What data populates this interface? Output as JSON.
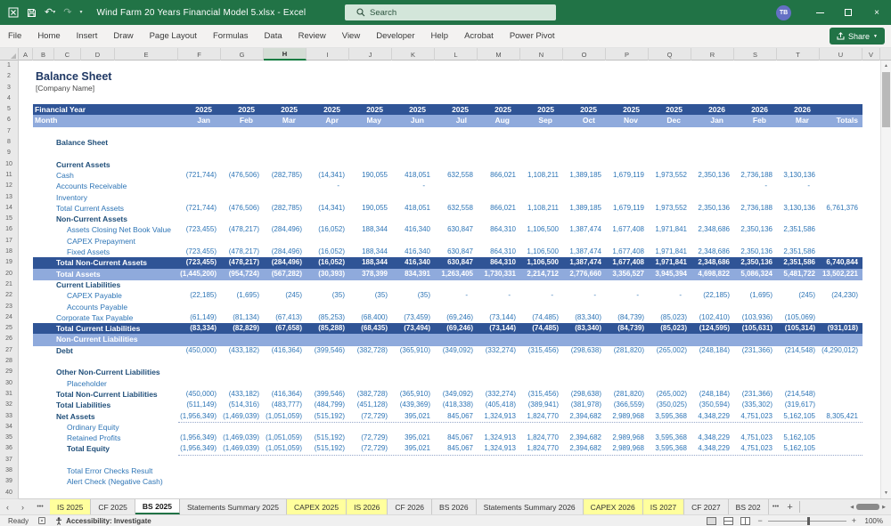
{
  "titlebar": {
    "app_title": "Wind Farm 20 Years Financial Model 5.xlsx  -  Excel",
    "search_placeholder": "Search",
    "avatar_initials": "TB"
  },
  "ribbon": {
    "tabs": [
      "File",
      "Home",
      "Insert",
      "Draw",
      "Page Layout",
      "Formulas",
      "Data",
      "Review",
      "View",
      "Developer",
      "Help",
      "Acrobat",
      "Power Pivot"
    ],
    "share_label": "Share"
  },
  "grid": {
    "columns": [
      "A",
      "B",
      "C",
      "D",
      "E",
      "F",
      "G",
      "H",
      "I",
      "J",
      "K",
      "L",
      "M",
      "N",
      "O",
      "P",
      "Q",
      "R",
      "S",
      "T",
      "U",
      "V"
    ],
    "selected_column": "H",
    "row_count": 40
  },
  "sheet": {
    "doc_title": "Balance Sheet",
    "company": "[Company Name]",
    "financial_year_label": "Financial Year",
    "month_label": "Month",
    "totals_label": "Totals",
    "years": [
      "2025",
      "2025",
      "2025",
      "2025",
      "2025",
      "2025",
      "2025",
      "2025",
      "2025",
      "2025",
      "2025",
      "2025",
      "2026",
      "2026",
      "2026"
    ],
    "months": [
      "Jan",
      "Feb",
      "Mar",
      "Apr",
      "May",
      "Jun",
      "Jul",
      "Aug",
      "Sep",
      "Oct",
      "Nov",
      "Dec",
      "Jan",
      "Feb",
      "Mar"
    ],
    "rows": [
      {
        "num": 2,
        "type": "doc-title",
        "label": "Balance Sheet"
      },
      {
        "num": 3,
        "type": "subtitle",
        "label": "[Company Name]"
      },
      {
        "num": 5,
        "type": "year-banner"
      },
      {
        "num": 6,
        "type": "month-banner"
      },
      {
        "num": 8,
        "type": "section",
        "label": "Balance Sheet"
      },
      {
        "num": 10,
        "type": "section",
        "label": "Current Assets"
      },
      {
        "num": 11,
        "type": "item",
        "label": "Cash",
        "values": [
          "(721,744)",
          "(476,506)",
          "(282,785)",
          "(14,341)",
          "190,055",
          "418,051",
          "632,558",
          "866,021",
          "1,108,211",
          "1,389,185",
          "1,679,119",
          "1,973,552",
          "2,350,136",
          "2,736,188",
          "3,130,136"
        ],
        "total": ""
      },
      {
        "num": 12,
        "type": "item",
        "label": "Accounts Receivable",
        "values": [
          "",
          "",
          "",
          "-",
          "",
          "-",
          "",
          "",
          "",
          "",
          "",
          "",
          "",
          "-",
          "-"
        ],
        "total": ""
      },
      {
        "num": 13,
        "type": "item",
        "label": "Inventory",
        "values": [],
        "total": ""
      },
      {
        "num": 14,
        "type": "item",
        "label": "Total Current Assets",
        "values": [
          "(721,744)",
          "(476,506)",
          "(282,785)",
          "(14,341)",
          "190,055",
          "418,051",
          "632,558",
          "866,021",
          "1,108,211",
          "1,389,185",
          "1,679,119",
          "1,973,552",
          "2,350,136",
          "2,736,188",
          "3,130,136"
        ],
        "total": "6,761,376"
      },
      {
        "num": 15,
        "type": "section",
        "label": "Non-Current Assets"
      },
      {
        "num": 16,
        "type": "item",
        "label": "Assets Closing Net Book Value",
        "indent": 1,
        "values": [
          "(723,455)",
          "(478,217)",
          "(284,496)",
          "(16,052)",
          "188,344",
          "416,340",
          "630,847",
          "864,310",
          "1,106,500",
          "1,387,474",
          "1,677,408",
          "1,971,841",
          "2,348,686",
          "2,350,136",
          "2,351,586"
        ],
        "total": ""
      },
      {
        "num": 17,
        "type": "item",
        "label": "CAPEX Prepayment",
        "indent": 1,
        "values": [],
        "total": ""
      },
      {
        "num": 18,
        "type": "item",
        "label": "Fixed Assets",
        "indent": 1,
        "values": [
          "(723,455)",
          "(478,217)",
          "(284,496)",
          "(16,052)",
          "188,344",
          "416,340",
          "630,847",
          "864,310",
          "1,106,500",
          "1,387,474",
          "1,677,408",
          "1,971,841",
          "2,348,686",
          "2,350,136",
          "2,351,586"
        ],
        "total": ""
      },
      {
        "num": 19,
        "type": "banner-dark",
        "label": "Total Non-Current Assets",
        "values": [
          "(723,455)",
          "(478,217)",
          "(284,496)",
          "(16,052)",
          "188,344",
          "416,340",
          "630,847",
          "864,310",
          "1,106,500",
          "1,387,474",
          "1,677,408",
          "1,971,841",
          "2,348,686",
          "2,350,136",
          "2,351,586"
        ],
        "total": "6,740,844"
      },
      {
        "num": 20,
        "type": "banner-light",
        "label": "Total Assets",
        "values": [
          "(1,445,200)",
          "(954,724)",
          "(567,282)",
          "(30,393)",
          "378,399",
          "834,391",
          "1,263,405",
          "1,730,331",
          "2,214,712",
          "2,776,660",
          "3,356,527",
          "3,945,394",
          "4,698,822",
          "5,086,324",
          "5,481,722"
        ],
        "total": "13,502,221"
      },
      {
        "num": 21,
        "type": "section",
        "label": "Current Liabilities"
      },
      {
        "num": 22,
        "type": "item",
        "label": "CAPEX Payable",
        "indent": 1,
        "values": [
          "(22,185)",
          "(1,695)",
          "(245)",
          "(35)",
          "(35)",
          "(35)",
          "-",
          "-",
          "-",
          "-",
          "-",
          "-",
          "(22,185)",
          "(1,695)",
          "(245)"
        ],
        "total": "(24,230)"
      },
      {
        "num": 23,
        "type": "item",
        "label": "Accounts Payable",
        "indent": 1,
        "values": [],
        "total": ""
      },
      {
        "num": 24,
        "type": "item",
        "label": "Corporate Tax Payable",
        "values": [
          "(61,149)",
          "(81,134)",
          "(67,413)",
          "(85,253)",
          "(68,400)",
          "(73,459)",
          "(69,246)",
          "(73,144)",
          "(74,485)",
          "(83,340)",
          "(84,739)",
          "(85,023)",
          "(102,410)",
          "(103,936)",
          "(105,069)"
        ],
        "total": ""
      },
      {
        "num": 25,
        "type": "banner-dark",
        "label": "Total Current Liabilities",
        "values": [
          "(83,334)",
          "(82,829)",
          "(67,658)",
          "(85,288)",
          "(68,435)",
          "(73,494)",
          "(69,246)",
          "(73,144)",
          "(74,485)",
          "(83,340)",
          "(84,739)",
          "(85,023)",
          "(124,595)",
          "(105,631)",
          "(105,314)"
        ],
        "total": "(931,018)"
      },
      {
        "num": 26,
        "type": "banner-light",
        "label": "Non-Current Liabilities",
        "values": [],
        "total": ""
      },
      {
        "num": 27,
        "type": "item-bold",
        "label": "Debt",
        "values": [
          "(450,000)",
          "(433,182)",
          "(416,364)",
          "(399,546)",
          "(382,728)",
          "(365,910)",
          "(349,092)",
          "(332,274)",
          "(315,456)",
          "(298,638)",
          "(281,820)",
          "(265,002)",
          "(248,184)",
          "(231,366)",
          "(214,548)"
        ],
        "total": "(4,290,012)"
      },
      {
        "num": 29,
        "type": "section",
        "label": "Other Non-Current Liabilities"
      },
      {
        "num": 30,
        "type": "item",
        "label": "Placeholder",
        "indent": 1,
        "values": [],
        "total": ""
      },
      {
        "num": 31,
        "type": "item-bold",
        "label": "Total Non-Current Liabilities",
        "values": [
          "(450,000)",
          "(433,182)",
          "(416,364)",
          "(399,546)",
          "(382,728)",
          "(365,910)",
          "(349,092)",
          "(332,274)",
          "(315,456)",
          "(298,638)",
          "(281,820)",
          "(265,002)",
          "(248,184)",
          "(231,366)",
          "(214,548)"
        ],
        "total": ""
      },
      {
        "num": 32,
        "type": "item-bold",
        "label": "Total Liabilities",
        "values": [
          "(511,149)",
          "(514,316)",
          "(483,777)",
          "(484,799)",
          "(451,128)",
          "(439,369)",
          "(418,338)",
          "(405,418)",
          "(389,941)",
          "(381,978)",
          "(366,559)",
          "(350,025)",
          "(350,594)",
          "(335,302)",
          "(319,617)"
        ],
        "total": ""
      },
      {
        "num": 33,
        "type": "item-bold",
        "label": "Net Assets",
        "underline": true,
        "values": [
          "(1,956,349)",
          "(1,469,039)",
          "(1,051,059)",
          "(515,192)",
          "(72,729)",
          "395,021",
          "845,067",
          "1,324,913",
          "1,824,770",
          "2,394,682",
          "2,989,968",
          "3,595,368",
          "4,348,229",
          "4,751,023",
          "5,162,105"
        ],
        "total": "8,305,421"
      },
      {
        "num": 34,
        "type": "item",
        "label": "Ordinary Equity",
        "indent": 1,
        "values": [],
        "total": ""
      },
      {
        "num": 35,
        "type": "item",
        "label": "Retained Profits",
        "indent": 1,
        "values": [
          "(1,956,349)",
          "(1,469,039)",
          "(1,051,059)",
          "(515,192)",
          "(72,729)",
          "395,021",
          "845,067",
          "1,324,913",
          "1,824,770",
          "2,394,682",
          "2,989,968",
          "3,595,368",
          "4,348,229",
          "4,751,023",
          "5,162,105"
        ],
        "total": ""
      },
      {
        "num": 36,
        "type": "item-bold",
        "label": "Total Equity",
        "indent": 1,
        "underline": true,
        "values": [
          "(1,956,349)",
          "(1,469,039)",
          "(1,051,059)",
          "(515,192)",
          "(72,729)",
          "395,021",
          "845,067",
          "1,324,913",
          "1,824,770",
          "2,394,682",
          "2,989,968",
          "3,595,368",
          "4,348,229",
          "4,751,023",
          "5,162,105"
        ],
        "total": ""
      },
      {
        "num": 38,
        "type": "item",
        "label": "Total Error Checks Result",
        "indent": 1,
        "values": [],
        "total": ""
      },
      {
        "num": 39,
        "type": "item",
        "label": "Alert Check (Negative Cash)",
        "indent": 1,
        "values": [],
        "total": ""
      }
    ]
  },
  "tabbar": {
    "nav_prev": "‹",
    "nav_next": "›",
    "more_left": "•••",
    "more_right": "•••",
    "add": "+",
    "tabs": [
      {
        "label": "IS 2025",
        "style": "yellow"
      },
      {
        "label": "CF 2025",
        "style": "normal"
      },
      {
        "label": "BS 2025",
        "style": "active"
      },
      {
        "label": "Statements Summary 2025",
        "style": "normal"
      },
      {
        "label": "CAPEX 2025",
        "style": "yellow"
      },
      {
        "label": "IS 2026",
        "style": "yellow"
      },
      {
        "label": "CF 2026",
        "style": "normal"
      },
      {
        "label": "BS 2026",
        "style": "normal"
      },
      {
        "label": "Statements Summary 2026",
        "style": "normal"
      },
      {
        "label": "CAPEX 2026",
        "style": "yellow"
      },
      {
        "label": "IS 2027",
        "style": "yellow"
      },
      {
        "label": "CF 2027",
        "style": "normal"
      },
      {
        "label": "BS 202",
        "style": "normal"
      }
    ]
  },
  "statusbar": {
    "ready": "Ready",
    "accessibility": "Accessibility: Investigate",
    "zoom": "100%"
  },
  "colors": {
    "excel_green": "#217346",
    "banner_dark": "#2f5496",
    "banner_light": "#8faadc",
    "text_blue": "#2e75b6",
    "section_blue": "#1f4e79",
    "tab_yellow": "#ffff9d"
  }
}
